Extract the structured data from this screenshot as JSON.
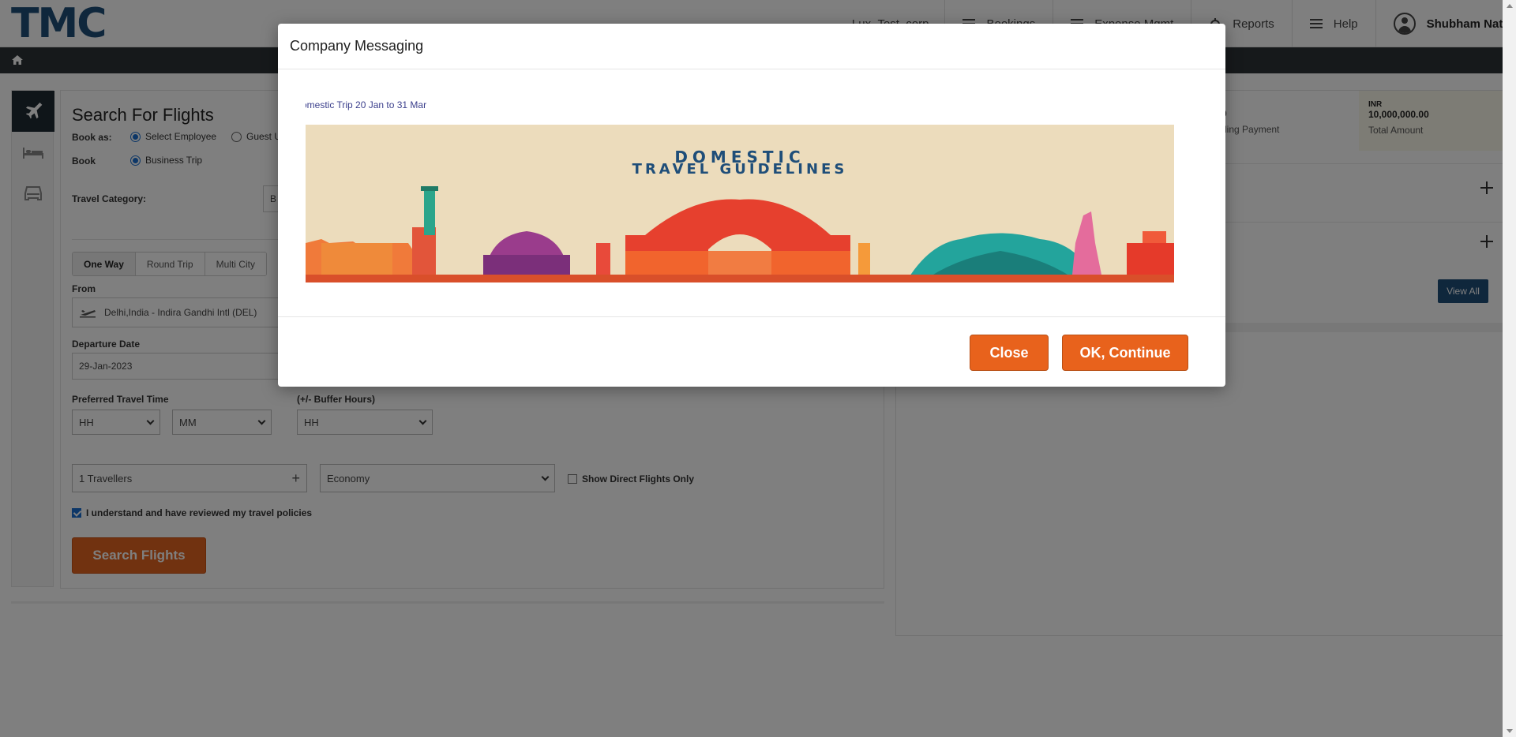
{
  "header": {
    "logo": "TMC",
    "org": "Lux_Test_corp",
    "nav": [
      "Bookings",
      "Expense Mgmt",
      "Reports",
      "Help"
    ],
    "user": "Shubham Natka"
  },
  "search": {
    "title": "Search For Flights",
    "book_as_label": "Book as:",
    "book_as_options": [
      "Select Employee",
      "Guest U"
    ],
    "book_label": "Book",
    "book_option": "Business Trip",
    "travel_category_label": "Travel Category:",
    "travel_category_value": "B",
    "trip_tabs": [
      "One Way",
      "Round Trip",
      "Multi City"
    ],
    "from_label": "From",
    "from_value": "Delhi,India - Indira Gandhi Intl (DEL)",
    "departure_label": "Departure Date",
    "departure_value": "29-Jan-2023",
    "pref_time_label": "Preferred Travel Time",
    "buffer_label": "(+/- Buffer Hours)",
    "hh": "HH",
    "mm": "MM",
    "travellers": "1 Travellers",
    "cabin": "Economy",
    "direct_only": "Show Direct Flights Only",
    "policy_check": "I understand and have reviewed my travel policies",
    "search_button": "Search Flights"
  },
  "right_panel": {
    "stat1_amount": "0",
    "stat1_caption": "ding Payment",
    "stat2_currency": "INR",
    "stat2_amount": "10,000,000.00",
    "stat2_caption": "Total Amount",
    "view_all": "View All"
  },
  "modal": {
    "title": "Company Messaging",
    "marquee": "omestic Trip 20 Jan to 31 Mar",
    "banner_line1": "DOMESTIC",
    "banner_line2": "TRAVEL GUIDELINES",
    "close": "Close",
    "ok": "OK, Continue"
  },
  "colors": {
    "brand": "#1f4e79",
    "accent": "#e8621c",
    "banner_bg": "#ecdcbc"
  }
}
